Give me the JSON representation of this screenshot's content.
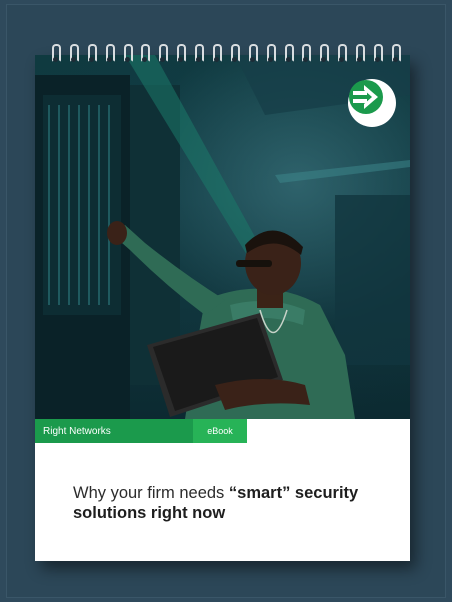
{
  "brand": {
    "name": "Right Networks"
  },
  "badge": {
    "label": "eBook"
  },
  "title": {
    "lead": "Why your firm needs ",
    "emphasis_1": "“smart” security",
    "emphasis_2": "solutions right now"
  },
  "icons": {
    "logo": "arrow-circle-logo-icon"
  },
  "colors": {
    "brand_green": "#1b9a4c",
    "badge_green": "#27b357",
    "background": "#2f4a5c"
  }
}
